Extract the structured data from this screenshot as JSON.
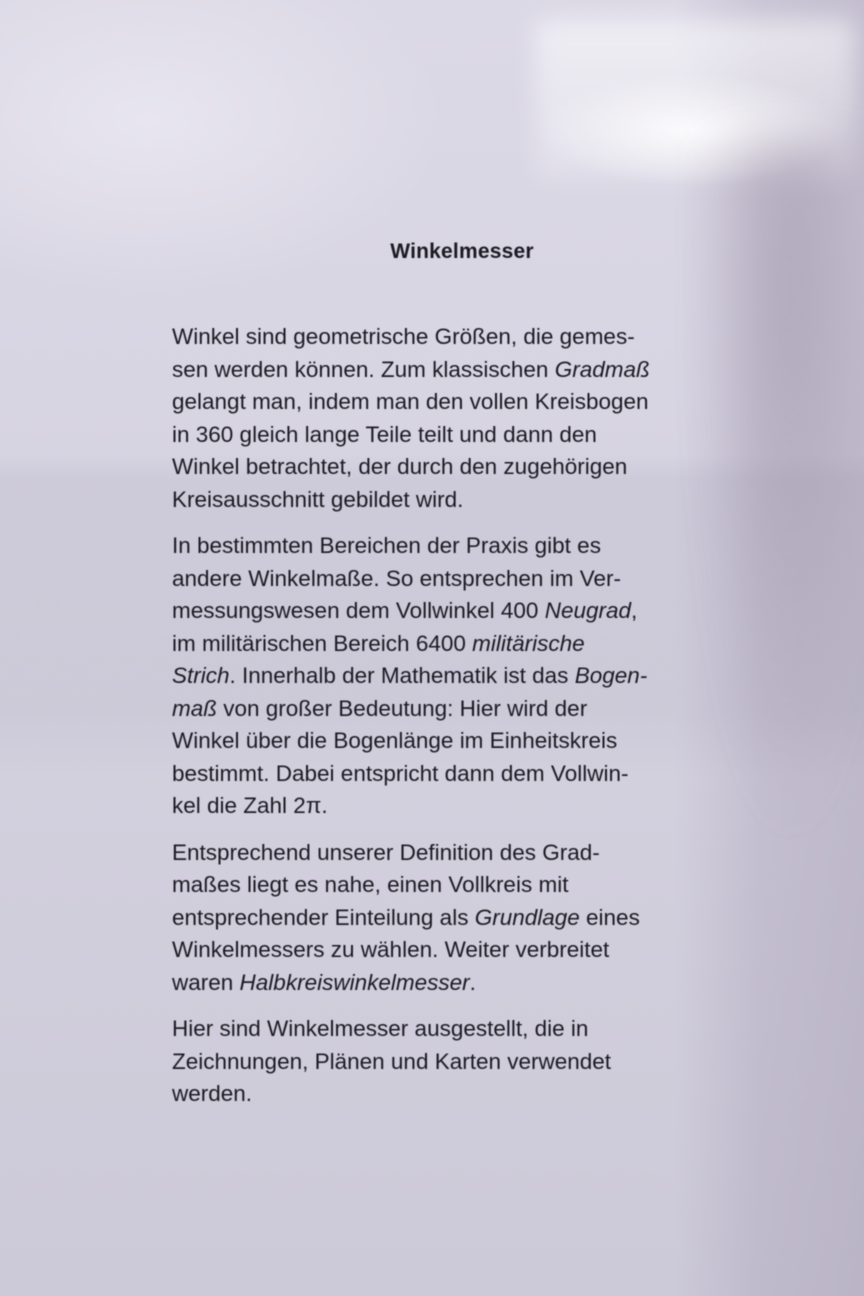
{
  "title": "Winkelmesser",
  "paragraphs": [
    {
      "lines": [
        "Winkel sind geometrische Größen, die gemes-",
        [
          "sen werden können. Zum klassischen ",
          {
            "i": "Gradmaß"
          }
        ],
        "gelangt man, indem man den vollen Kreisbogen",
        "in 360 gleich lange Teile teilt und dann den",
        "Winkel betrachtet, der durch den zugehörigen",
        "Kreisausschnitt gebildet wird."
      ]
    },
    {
      "lines": [
        "In bestimmten Bereichen der Praxis gibt es",
        "andere Winkelmaße. So entsprechen im Ver-",
        [
          "messungswesen dem Vollwinkel 400 ",
          {
            "i": "Neugrad"
          },
          ","
        ],
        [
          "im militärischen Bereich 6400 ",
          {
            "i": "militärische"
          }
        ],
        [
          {
            "i": "Strich"
          },
          ". Innerhalb der Mathematik ist das ",
          {
            "i": "Bogen-"
          }
        ],
        [
          {
            "i": "maß"
          },
          " von großer Bedeutung: Hier wird der"
        ],
        "Winkel über die Bogenlänge im Einheitskreis",
        "bestimmt. Dabei entspricht dann dem Vollwin-",
        "kel die Zahl 2π."
      ]
    },
    {
      "lines": [
        "Entsprechend unserer Definition des Grad-",
        "maßes liegt es nahe, einen Vollkreis mit",
        [
          "entsprechender Einteilung als ",
          {
            "i": "Grundlage"
          },
          " eines"
        ],
        "Winkelmessers zu wählen. Weiter verbreitet",
        [
          "waren ",
          {
            "i": "Halbkreiswinkelmesser"
          },
          "."
        ]
      ]
    },
    {
      "lines": [
        "Hier sind Winkelmesser ausgestellt, die in",
        "Zeichnungen, Plänen und Karten verwendet",
        "werden."
      ]
    }
  ]
}
